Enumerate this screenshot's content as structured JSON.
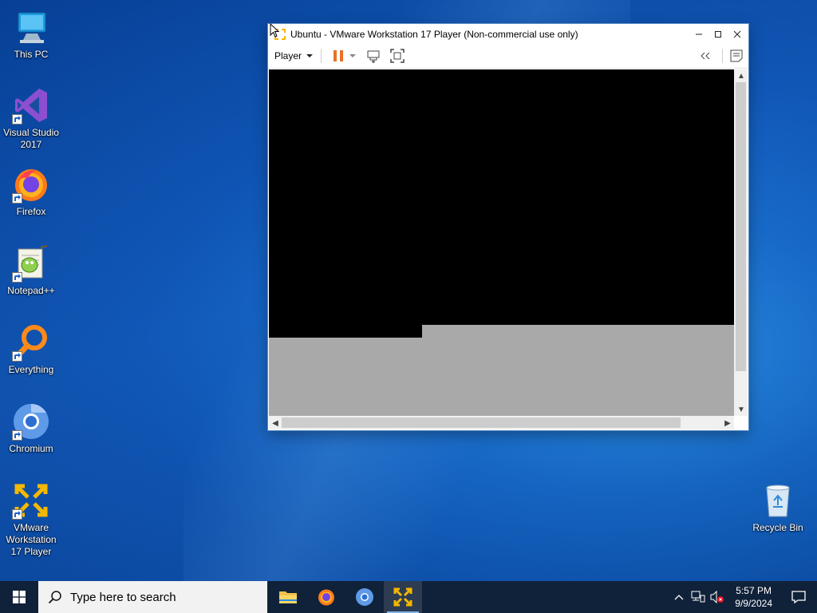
{
  "desktop": {
    "icons": [
      {
        "label": "This PC"
      },
      {
        "label": "Visual Studio 2017"
      },
      {
        "label": "Firefox"
      },
      {
        "label": "Notepad++"
      },
      {
        "label": "Everything"
      },
      {
        "label": "Chromium"
      },
      {
        "label": "VMware Workstation 17 Player"
      },
      {
        "label": "Recycle Bin"
      }
    ]
  },
  "window": {
    "title": "Ubuntu - VMware Workstation 17 Player (Non-commercial use only)",
    "menu_label": "Player",
    "buttons": [
      "minimize",
      "maximize",
      "close"
    ]
  },
  "taskbar": {
    "search_placeholder": "Type here to search",
    "apps": [
      "File Explorer",
      "Firefox",
      "Chromium",
      "VMware Workstation 17 Player"
    ],
    "time": "5:57 PM",
    "date": "9/9/2024"
  },
  "colors": {
    "accent": "#0b4fae",
    "taskbar": "#10213a",
    "pause_orange": "#e8702a"
  }
}
